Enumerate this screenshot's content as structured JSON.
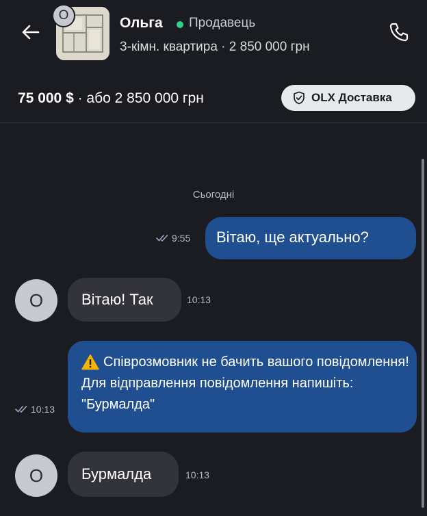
{
  "header": {
    "seller_name": "Ольга",
    "seller_role": "Продавець",
    "listing_subtitle": "3-кімн. квартира · 2 850 000 грн",
    "thumbnail_badge": "O",
    "back_icon": "arrow-left-icon",
    "phone_icon": "phone-icon",
    "online_color": "#2fd18f"
  },
  "price_bar": {
    "price_bold": "75 000 $",
    "price_rest": " · або 2 850 000 грн",
    "delivery_label": "OLX Доставка",
    "delivery_icon": "shield-check-icon"
  },
  "chat": {
    "date_separator": "Сьогодні",
    "messages": [
      {
        "direction": "outgoing",
        "text": "Вітаю, ще актуально?",
        "time": "9:55",
        "status": "read"
      },
      {
        "direction": "incoming",
        "avatar": "O",
        "text": "Вітаю! Так",
        "time": "10:13"
      },
      {
        "direction": "outgoing",
        "text": "Співрозмовник не бачить вашого повідомлення! Для відправлення повідомлення напишіть: \"Бурмалда\"",
        "time": "10:13",
        "status": "sent",
        "icon": "warning-icon"
      },
      {
        "direction": "incoming",
        "avatar": "O",
        "text": "Бурмалда",
        "time": "10:13"
      }
    ]
  },
  "colors": {
    "background": "#1b1c22",
    "outgoing_bubble": "#1f4f91",
    "incoming_bubble": "#33343b",
    "delivery_button": "#e7e9ec"
  }
}
